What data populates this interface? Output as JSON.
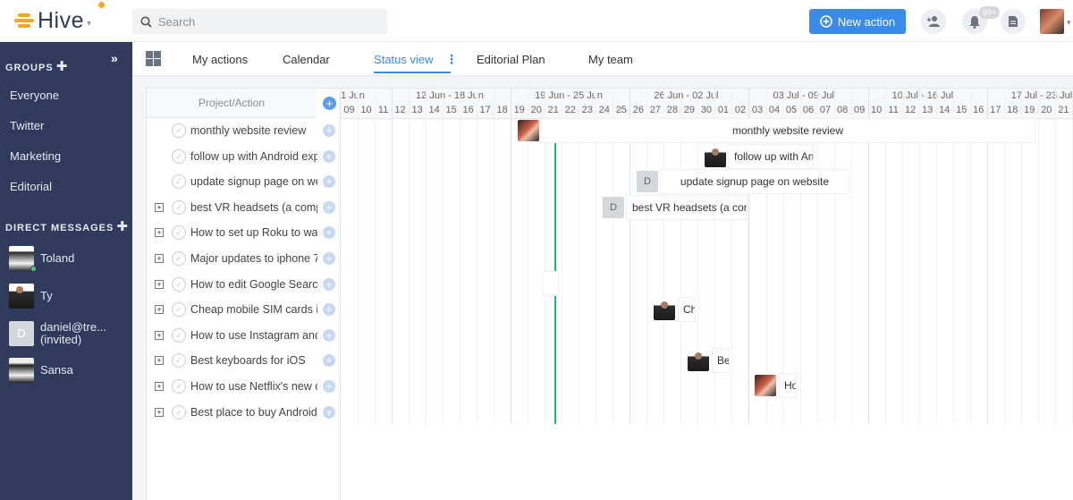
{
  "app": {
    "name": "Hive",
    "search_placeholder": "Search",
    "new_action_label": "New action",
    "notifications_badge": "99+",
    "accent_color": "#3b8beb",
    "sidebar_color": "#2f3a5c",
    "today_color": "#1fb86a"
  },
  "sidebar": {
    "groups_label": "GROUPS",
    "groups": [
      "Everyone",
      "Twitter",
      "Marketing",
      "Editorial"
    ],
    "dm_label": "DIRECT MESSAGES",
    "dms": [
      {
        "name": "Toland"
      },
      {
        "name": "Ty"
      },
      {
        "name": "daniel@tre...",
        "sub": "(invited)",
        "initial": "D"
      },
      {
        "name": "Sansa"
      }
    ]
  },
  "tabs": [
    "My actions",
    "Calendar",
    "Status view",
    "Editorial Plan",
    "My team"
  ],
  "active_tab": "Status view",
  "gantt": {
    "column_header": "Project/Action",
    "weeks": [
      "1 Jun",
      "12 Jun - 18 Jun",
      "19 Jun - 25 Jun",
      "26 Jun - 02 Jul",
      "03 Jul - 09 Jul",
      "10 Jul - 16 Jul",
      "17 Jul - 23 Jul"
    ],
    "days": [
      "09",
      "10",
      "11",
      "12",
      "13",
      "14",
      "15",
      "16",
      "17",
      "18",
      "19",
      "20",
      "21",
      "22",
      "23",
      "24",
      "25",
      "26",
      "27",
      "28",
      "29",
      "30",
      "01",
      "02",
      "03",
      "04",
      "05",
      "06",
      "07",
      "08",
      "09",
      "10",
      "11",
      "12",
      "13",
      "14",
      "15",
      "16",
      "17",
      "18",
      "19",
      "20",
      "21"
    ],
    "rows": [
      {
        "title": "monthly website review",
        "expandable": false,
        "bar": "monthly website review"
      },
      {
        "title": "follow up with Android experts",
        "expandable": false,
        "bar": "follow up with Android"
      },
      {
        "title": "update signup page on website",
        "expandable": false,
        "bar": "update signup page on website",
        "initial": "D"
      },
      {
        "title": "best VR headsets (a comparison)",
        "expandable": true,
        "bar": "best VR headsets (a comparison)",
        "initial": "D"
      },
      {
        "title": "How to set up Roku to watch",
        "expandable": true
      },
      {
        "title": "Major updates to iphone 7",
        "expandable": true
      },
      {
        "title": "How to edit Google Search",
        "expandable": true
      },
      {
        "title": "Cheap mobile SIM cards in",
        "expandable": true,
        "bar": "Cheap mobile SIM cards"
      },
      {
        "title": "How to use Instagram and",
        "expandable": true
      },
      {
        "title": "Best keyboards for iOS",
        "expandable": true,
        "bar": "Best keyboards for iOS"
      },
      {
        "title": "How to use Netflix's new offline",
        "expandable": true,
        "bar": "How to use Netflix"
      },
      {
        "title": "Best place to buy Android",
        "expandable": true
      }
    ]
  }
}
